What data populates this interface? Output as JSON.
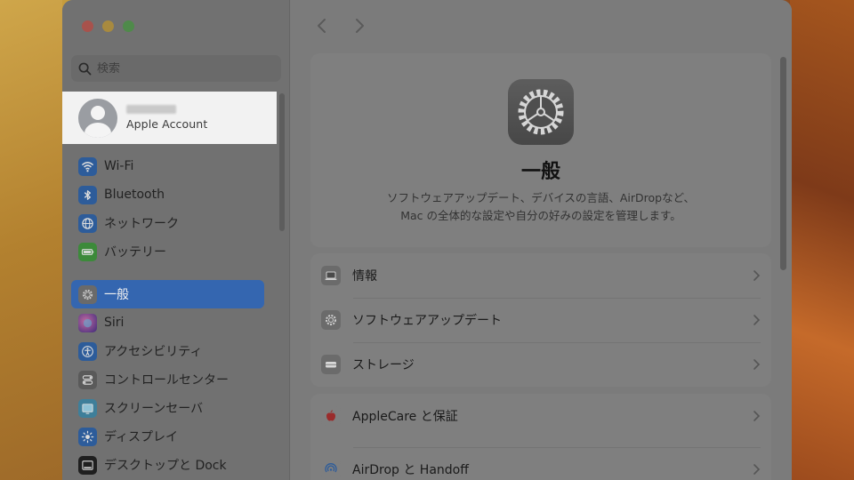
{
  "search": {
    "placeholder": "検索"
  },
  "account": {
    "label": "Apple Account"
  },
  "sidebar": {
    "items": [
      {
        "label": "Wi-Fi",
        "icon": "wifi-icon",
        "color": "#2d5c9a"
      },
      {
        "label": "Bluetooth",
        "icon": "bluetooth-icon",
        "color": "#2d5c9a"
      },
      {
        "label": "ネットワーク",
        "icon": "globe-icon",
        "color": "#2d5c9a"
      },
      {
        "label": "バッテリー",
        "icon": "battery-icon",
        "color": "#3c8a3a"
      },
      {
        "label": "一般",
        "icon": "gear-icon",
        "color": "#6a6a6a",
        "selected": true
      },
      {
        "label": "Siri",
        "icon": "siri-icon",
        "color": "#5a3a7a"
      },
      {
        "label": "アクセシビリティ",
        "icon": "accessibility-icon",
        "color": "#2d5c9a"
      },
      {
        "label": "コントロールセンター",
        "icon": "control-center-icon",
        "color": "#5a5a5a"
      },
      {
        "label": "スクリーンセーバ",
        "icon": "screensaver-icon",
        "color": "#3e7f9a"
      },
      {
        "label": "ディスプレイ",
        "icon": "display-icon",
        "color": "#2d5c9a"
      },
      {
        "label": "デスクトップと Dock",
        "icon": "dock-icon",
        "color": "#1f1f1f"
      }
    ]
  },
  "main": {
    "title": "一般",
    "description_line1": "ソフトウェアアップデート、デバイスの言語、AirDropなど、",
    "description_line2": "Mac の全体的な設定や自分の好みの設定を管理します。",
    "group1": [
      {
        "label": "情報",
        "icon": "laptop-icon"
      },
      {
        "label": "ソフトウェアアップデート",
        "icon": "gear-badge-icon"
      },
      {
        "label": "ストレージ",
        "icon": "storage-icon"
      }
    ],
    "group2": [
      {
        "label": "AppleCare と保証",
        "icon": "apple-icon"
      },
      {
        "label": "AirDrop と Handoff",
        "icon": "airdrop-icon"
      }
    ]
  },
  "colors": {
    "accent": "#3466b0"
  }
}
